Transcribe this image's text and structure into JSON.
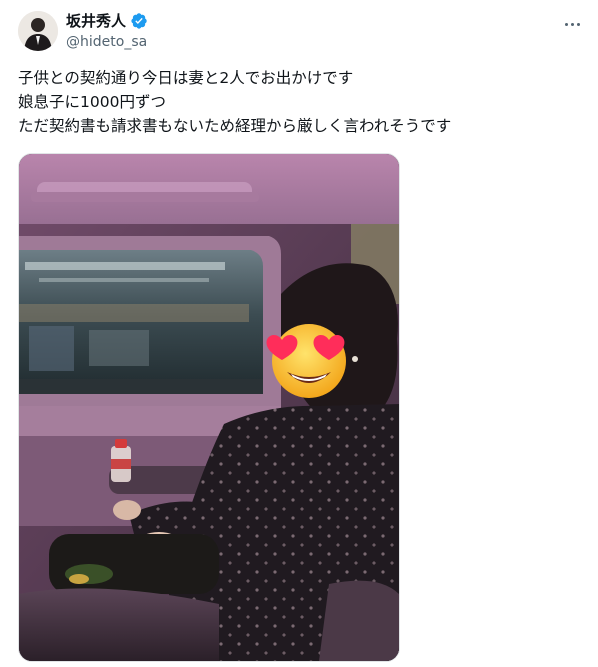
{
  "header": {
    "display_name": "坂井秀人",
    "handle": "@hideto_sa",
    "verified": true,
    "avatar_icon": "person-avatar-icon",
    "more_icon": "more-options-icon"
  },
  "tweet": {
    "lines": [
      "子供との契約通り今日は妻と2人でお出かけです",
      "娘息子に1000円ずつ",
      "ただ契約書も請求書もないため経理から厳しく言われそうです"
    ]
  },
  "media": {
    "scene": "car-interior-photo",
    "emoji_icon": "heart-eyes-emoji-icon"
  },
  "colors": {
    "verified": "#1d9bf0",
    "handle": "#536471",
    "text": "#0f1419",
    "cabin": "#6e4f6c"
  }
}
